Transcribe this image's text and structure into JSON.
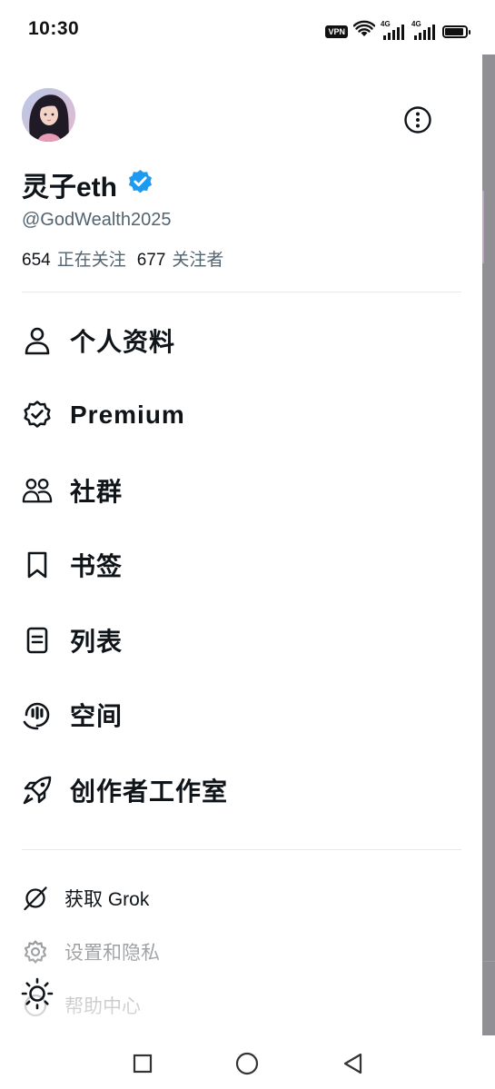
{
  "status_bar": {
    "time": "10:30",
    "vpn_label": "VPN",
    "signal_1_label": "4G",
    "signal_2_label": "4G",
    "icons": [
      "vpn-icon",
      "wifi-icon",
      "signal-icon",
      "signal-icon",
      "battery-icon"
    ]
  },
  "profile": {
    "display_name": "灵子eth",
    "verified": true,
    "handle": "@GodWealth2025",
    "following_count": "654",
    "following_label": "正在关注",
    "followers_count": "677",
    "followers_label": "关注者"
  },
  "menu": {
    "items": [
      {
        "label": "个人资料",
        "icon": "person-icon"
      },
      {
        "label": "Premium",
        "icon": "premium-badge-icon"
      },
      {
        "label": "社群",
        "icon": "communities-icon"
      },
      {
        "label": "书签",
        "icon": "bookmark-icon"
      },
      {
        "label": "列表",
        "icon": "lists-icon"
      },
      {
        "label": "空间",
        "icon": "spaces-icon"
      },
      {
        "label": "创作者工作室",
        "icon": "rocket-icon"
      }
    ],
    "secondary": [
      {
        "label": "获取 Grok",
        "icon": "grok-icon"
      },
      {
        "label": "设置和隐私",
        "icon": "settings-icon"
      },
      {
        "label": "帮助中心",
        "icon": "help-icon"
      }
    ]
  },
  "colors": {
    "text_primary": "#0f1419",
    "text_secondary": "#536471",
    "verified_blue": "#1d9bf0",
    "divider": "#e7e9ea"
  }
}
